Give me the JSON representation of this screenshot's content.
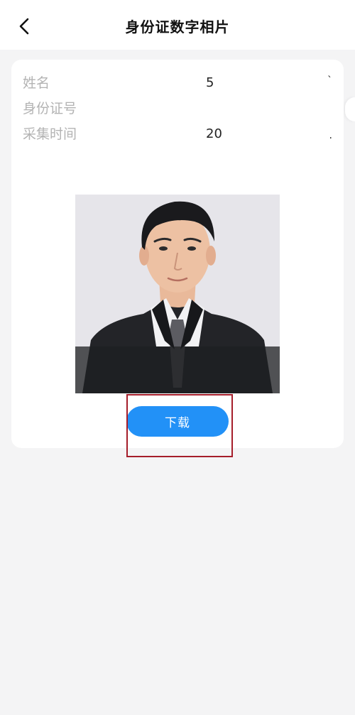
{
  "header": {
    "title": "身份证数字相片",
    "back_icon": "chevron-left-icon"
  },
  "info": {
    "name_label": "姓名",
    "name_value": "5",
    "name_tail": "`",
    "id_label": "身份证号",
    "id_value": "",
    "time_label": "采集时间",
    "time_value": "20",
    "time_tail": "."
  },
  "actions": {
    "download_label": "下载"
  },
  "colors": {
    "accent": "#2291f7",
    "highlight": "#a51d2a",
    "background": "#f4f4f5"
  }
}
